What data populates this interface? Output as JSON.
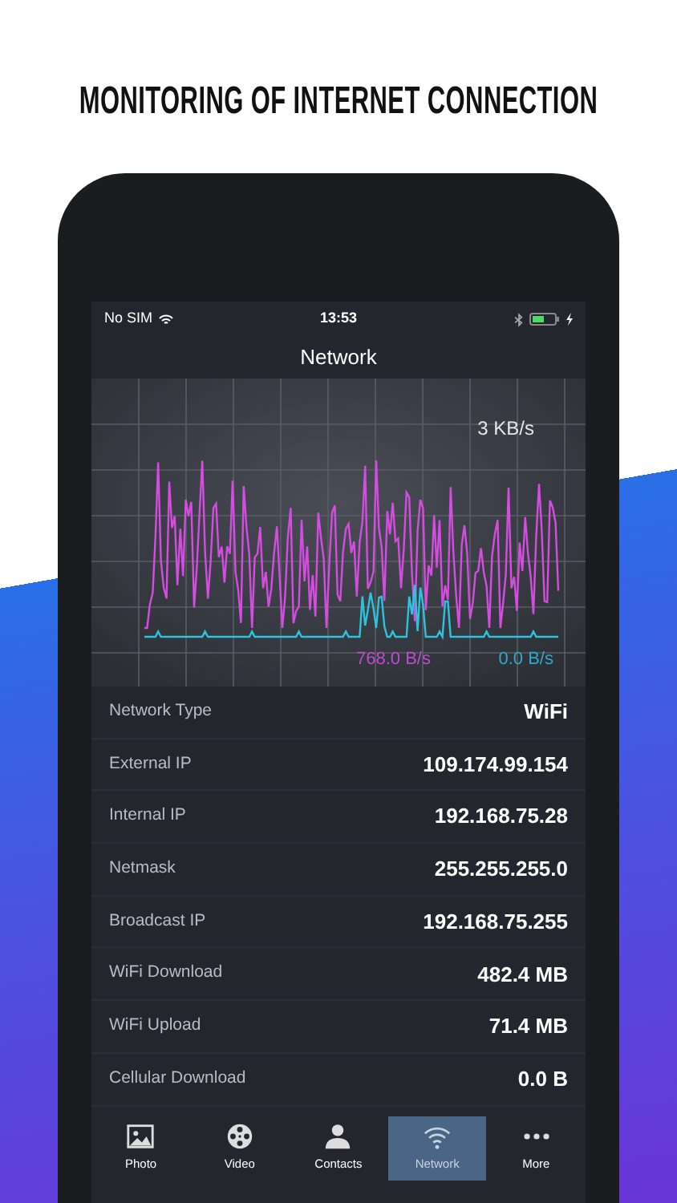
{
  "headline": "MONITORING OF INTERNET CONNECTION",
  "status_bar": {
    "carrier": "No SIM",
    "time": "13:53"
  },
  "nav_title": "Network",
  "graph": {
    "scale_label": "3 KB/s",
    "download_rate": "768.0 B/s",
    "upload_rate": "0.0 B/s"
  },
  "rows": [
    {
      "label": "Network Type",
      "value": "WiFi"
    },
    {
      "label": "External IP",
      "value": "109.174.99.154"
    },
    {
      "label": "Internal IP",
      "value": "192.168.75.28"
    },
    {
      "label": "Netmask",
      "value": "255.255.255.0"
    },
    {
      "label": "Broadcast IP",
      "value": "192.168.75.255"
    },
    {
      "label": "WiFi Download",
      "value": "482.4 MB"
    },
    {
      "label": "WiFi Upload",
      "value": "71.4 MB"
    },
    {
      "label": "Cellular Download",
      "value": "0.0 B"
    }
  ],
  "tabs": [
    {
      "kind": "photo",
      "label": "Photo",
      "selected": false
    },
    {
      "kind": "video",
      "label": "Video",
      "selected": false
    },
    {
      "kind": "contacts",
      "label": "Contacts",
      "selected": false
    },
    {
      "kind": "network",
      "label": "Network",
      "selected": true
    },
    {
      "kind": "more",
      "label": "More",
      "selected": false
    }
  ]
}
